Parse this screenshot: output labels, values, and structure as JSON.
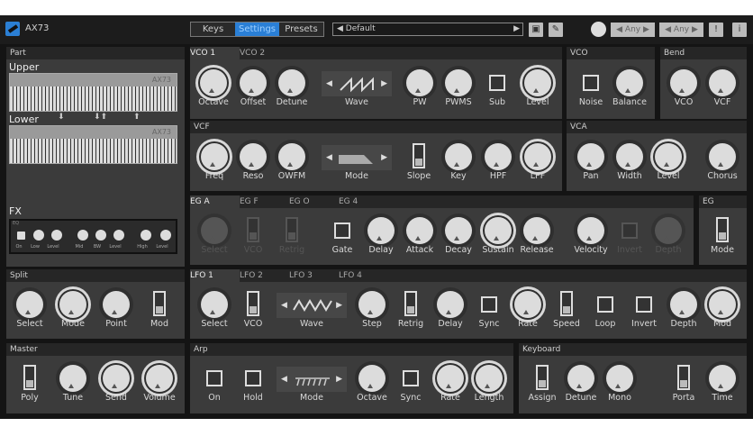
{
  "header": {
    "app_title": "AX73",
    "tabs": [
      "Keys",
      "Settings",
      "Presets"
    ],
    "active_tab": "Settings",
    "preset": "Default",
    "channel_1": "Any",
    "channel_2": "Any",
    "alert_label": "!",
    "info_label": "i"
  },
  "part": {
    "title": "Part",
    "upper": "Upper",
    "lower": "Lower",
    "kb_brand": "AX73",
    "fx_title": "FX",
    "fx_eq": "EQ",
    "fx_labels": [
      "On",
      "Low",
      "Level",
      "Mid",
      "BW",
      "Level",
      "High",
      "Level"
    ]
  },
  "vco": {
    "tabs": [
      "VCO 1",
      "VCO 2"
    ],
    "controls": [
      "Octave",
      "Offset",
      "Detune",
      "Wave",
      "PW",
      "PWMS",
      "Sub",
      "Level"
    ]
  },
  "vco_mix": {
    "title": "VCO",
    "controls": [
      "Noise",
      "Balance"
    ]
  },
  "bend": {
    "title": "Bend",
    "controls": [
      "VCO",
      "VCF"
    ]
  },
  "vcf": {
    "title": "VCF",
    "controls": [
      "Freq",
      "Reso",
      "OWFM",
      "Mode",
      "Slope",
      "Key",
      "HPF",
      "LPF"
    ]
  },
  "vca": {
    "title": "VCA",
    "controls": [
      "Pan",
      "Width",
      "Level",
      "Chorus"
    ]
  },
  "eg": {
    "tabs": [
      "EG A",
      "EG F",
      "EG O",
      "EG 4"
    ],
    "controls": [
      "Select",
      "VCO",
      "Retrig",
      "Gate",
      "Delay",
      "Attack",
      "Decay",
      "Sustain",
      "Release",
      "Velocity",
      "Invert",
      "Depth"
    ]
  },
  "eg_mode": {
    "title": "EG",
    "controls": [
      "Mode"
    ]
  },
  "split": {
    "title": "Split",
    "controls": [
      "Select",
      "Mode",
      "Point",
      "Mod"
    ]
  },
  "lfo": {
    "tabs": [
      "LFO 1",
      "LFO 2",
      "LFO 3",
      "LFO 4"
    ],
    "controls": [
      "Select",
      "VCO",
      "Wave",
      "Step",
      "Retrig",
      "Delay",
      "Sync",
      "Rate",
      "Speed",
      "Loop",
      "Invert",
      "Depth",
      "Mod"
    ]
  },
  "master": {
    "title": "Master",
    "controls": [
      "Poly",
      "Tune",
      "Send",
      "Volume"
    ]
  },
  "arp": {
    "title": "Arp",
    "controls": [
      "On",
      "Hold",
      "Mode",
      "Octave",
      "Sync",
      "Rate",
      "Length"
    ]
  },
  "keyboard": {
    "title": "Keyboard",
    "controls": [
      "Assign",
      "Detune",
      "Mono",
      "Porta",
      "Time"
    ]
  }
}
